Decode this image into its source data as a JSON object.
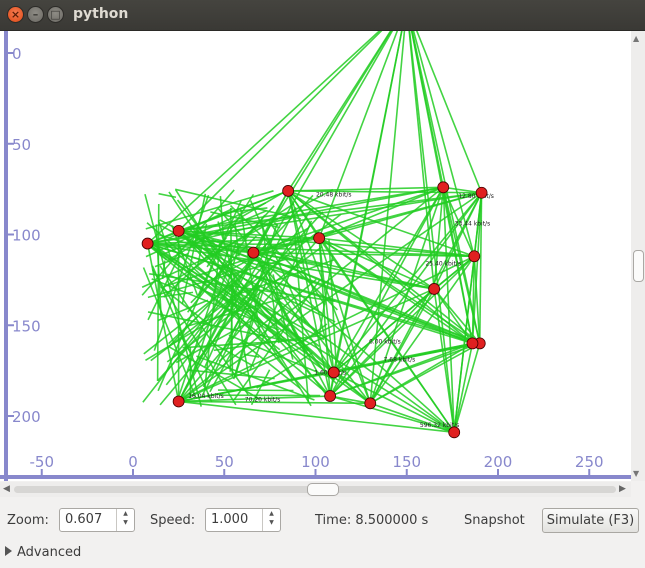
{
  "window": {
    "title": "python"
  },
  "plot": {
    "y_ticks": [
      "0",
      "50",
      "100",
      "150",
      "200"
    ],
    "x_ticks": [
      "-50",
      "0",
      "50",
      "100",
      "150",
      "200",
      "250"
    ],
    "axis_color": "#8888cc",
    "node_color": "#e02020",
    "edge_color": "#22cc22",
    "top_label": "5.50 kbit/s",
    "edge_labels": [
      "20.48 kbit/s",
      "12.80 kbit/s",
      "25.40 kbit/s",
      "33.44 kbit/s",
      "596.32 kbit/s",
      "16.04 kbit/s",
      "7.68 kbit/s",
      "6.00 kbit/s",
      "1.60 kbit/s",
      "70.20 kbit/s"
    ]
  },
  "controls": {
    "zoom_label": "Zoom:",
    "zoom_value": "0.607",
    "speed_label": "Speed:",
    "speed_value": "1.000",
    "time_text": "Time: 8.500000 s",
    "snapshot_label": "Snapshot",
    "simulate_label": "Simulate (F3)"
  },
  "advanced": {
    "label": "Advanced"
  }
}
